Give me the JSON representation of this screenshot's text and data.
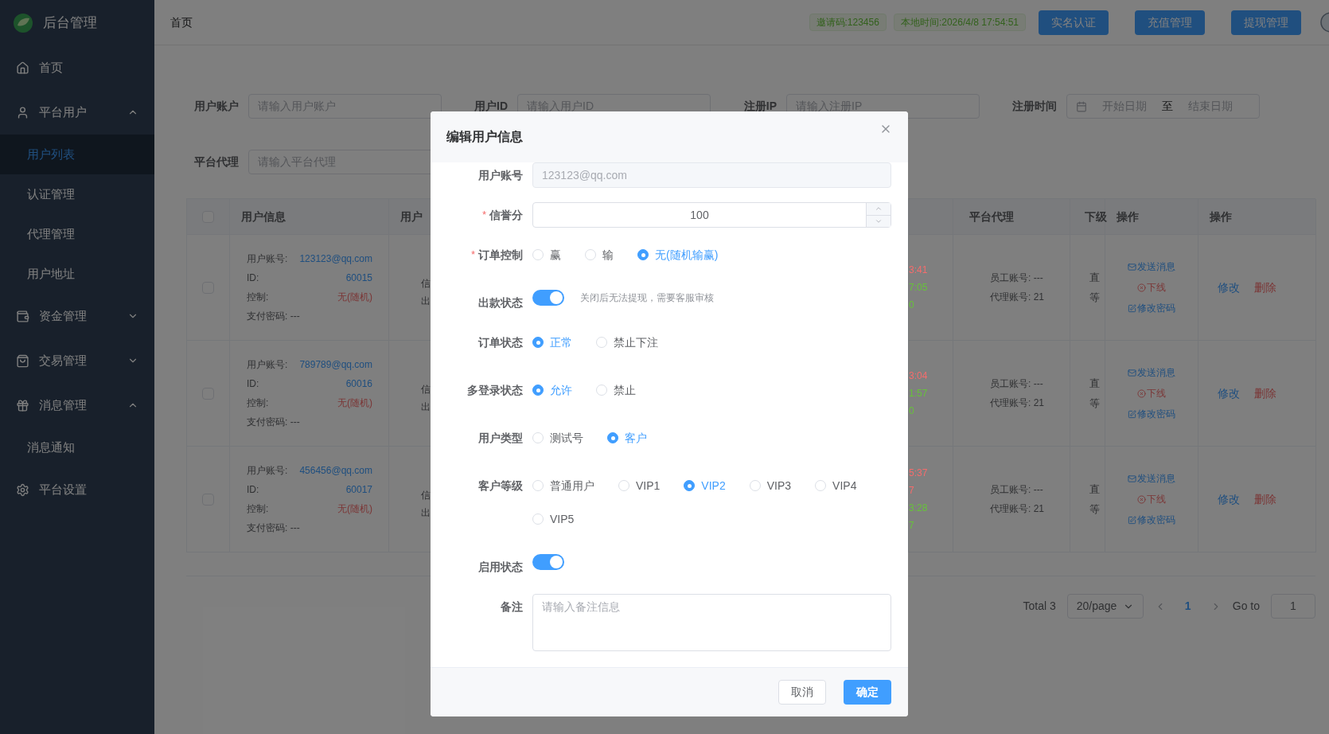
{
  "sidebar": {
    "logo_text": "后台管理",
    "items": [
      {
        "label": "首页",
        "selected": false
      },
      {
        "label": "平台用户",
        "selected": false,
        "expanded": true,
        "children": [
          {
            "label": "用户列表",
            "selected": true
          },
          {
            "label": "认证管理",
            "selected": false
          },
          {
            "label": "代理管理",
            "selected": false
          },
          {
            "label": "用户地址",
            "selected": false
          }
        ]
      },
      {
        "label": "资金管理",
        "selected": false,
        "expanded": false
      },
      {
        "label": "交易管理",
        "selected": false,
        "expanded": false
      },
      {
        "label": "消息管理",
        "selected": false,
        "expanded": true,
        "children": [
          {
            "label": "消息通知",
            "selected": false
          }
        ]
      },
      {
        "label": "平台设置",
        "selected": false
      }
    ]
  },
  "topbar": {
    "breadcrumb": "首页",
    "badges": [
      "邀请码:123456",
      "本地时间:2026/4/8 17:54:51"
    ],
    "buttons": [
      "实名认证",
      "充值管理",
      "提现管理"
    ]
  },
  "filters": [
    {
      "label": "用户账户",
      "placeholder": "请输入用户账户"
    },
    {
      "label": "用户ID",
      "placeholder": "请输入用户ID"
    },
    {
      "label": "注册IP",
      "placeholder": "请输入注册IP"
    },
    {
      "label": "平台代理",
      "placeholder": "请输入平台代理"
    }
  ],
  "date_filter": {
    "label": "注册时间",
    "start_placeholder": "开始日期",
    "separator": "至",
    "end_placeholder": "结束日期"
  },
  "table": {
    "all_checked": false,
    "columns": [
      "用户信息",
      "用户",
      "平台代理",
      "下级",
      "操作",
      "操作"
    ],
    "rows": [
      {
        "checked": false,
        "account_label": "用户账号:",
        "account": "123123@qq.com",
        "id_label": "ID:",
        "id": "60015",
        "control_label": "控制:",
        "control": "无(随机)",
        "pay_password": "支付密码: ---",
        "status_fragments": [
          "信",
          "出"
        ],
        "time_fragments": [
          {
            "text": "3:41",
            "color": "#f56c6c"
          },
          {
            "text": "7:05",
            "color": "#67c23a"
          },
          {
            "text": "0",
            "color": "#67c23a"
          }
        ],
        "staff": "员工账号: ---",
        "agent": "代理账号: 21",
        "level_fragments": [
          "直",
          "等"
        ],
        "actions": [
          {
            "kind": "message",
            "label": "发送消息"
          },
          {
            "kind": "offline",
            "label": "下线"
          },
          {
            "kind": "password",
            "label": "修改密码"
          }
        ],
        "ops": [
          {
            "kind": "edit",
            "label": "修改"
          },
          {
            "kind": "delete",
            "label": "删除"
          }
        ]
      },
      {
        "checked": false,
        "account_label": "用户账号:",
        "account": "789789@qq.com",
        "id_label": "ID:",
        "id": "60016",
        "control_label": "控制:",
        "control": "无(随机)",
        "pay_password": "支付密码: ---",
        "status_fragments": [
          "信",
          "出"
        ],
        "time_fragments": [
          {
            "text": "3:04",
            "color": "#f56c6c"
          },
          {
            "text": "1:57",
            "color": "#67c23a"
          },
          {
            "text": "0",
            "color": "#67c23a"
          }
        ],
        "staff": "员工账号: ---",
        "agent": "代理账号: 21",
        "level_fragments": [
          "直",
          "等"
        ],
        "actions": [
          {
            "kind": "message",
            "label": "发送消息"
          },
          {
            "kind": "offline",
            "label": "下线"
          },
          {
            "kind": "password",
            "label": "修改密码"
          }
        ],
        "ops": [
          {
            "kind": "edit",
            "label": "修改"
          },
          {
            "kind": "delete",
            "label": "删除"
          }
        ]
      },
      {
        "checked": false,
        "account_label": "用户账号:",
        "account": "456456@qq.com",
        "id_label": "ID:",
        "id": "60017",
        "control_label": "控制:",
        "control": "无(随机)",
        "pay_password": "支付密码: ---",
        "status_fragments": [
          "信",
          "出"
        ],
        "time_fragments": [
          {
            "text": "5:37",
            "color": "#f56c6c"
          },
          {
            "text": "7",
            "color": "#f56c6c"
          },
          {
            "text": "3:28",
            "color": "#67c23a"
          },
          {
            "text": "7",
            "color": "#67c23a"
          }
        ],
        "staff": "员工账号: ---",
        "agent": "代理账号: 21",
        "level_fragments": [
          "直",
          "等"
        ],
        "actions": [
          {
            "kind": "message",
            "label": "发送消息"
          },
          {
            "kind": "offline",
            "label": "下线"
          },
          {
            "kind": "password",
            "label": "修改密码"
          }
        ],
        "ops": [
          {
            "kind": "edit",
            "label": "修改"
          },
          {
            "kind": "delete",
            "label": "删除"
          }
        ]
      }
    ]
  },
  "pagination": {
    "total": "Total 3",
    "page_size": "20/page",
    "pages": [
      {
        "label": "1",
        "selected": true
      }
    ],
    "goto_label": "Go to",
    "goto_value": "1"
  },
  "modal": {
    "title": "编辑用户信息",
    "fields": [
      {
        "kind": "text",
        "label": "用户账号",
        "disabled": true,
        "value": "123123@qq.com"
      },
      {
        "kind": "number",
        "label": "信誉分",
        "required_mark": "*",
        "value": "100"
      },
      {
        "kind": "radio",
        "label": "订单控制",
        "required_mark": "*",
        "options": [
          {
            "label": "赢",
            "selected": false
          },
          {
            "label": "输",
            "selected": false
          },
          {
            "label": "无(随机输赢)",
            "selected": true
          }
        ]
      },
      {
        "kind": "switch",
        "label": "出款状态",
        "on": true,
        "hint": "关闭后无法提现，需要客服审核"
      },
      {
        "kind": "radio",
        "label": "订单状态",
        "options": [
          {
            "label": "正常",
            "selected": true
          },
          {
            "label": "禁止下注",
            "selected": false
          }
        ]
      },
      {
        "kind": "radio",
        "label": "多登录状态",
        "options": [
          {
            "label": "允许",
            "selected": true
          },
          {
            "label": "禁止",
            "selected": false
          }
        ]
      },
      {
        "kind": "radio",
        "label": "用户类型",
        "options": [
          {
            "label": "测试号",
            "selected": false
          },
          {
            "label": "客户",
            "selected": true
          }
        ]
      },
      {
        "kind": "radio",
        "label": "客户等级",
        "options": [
          {
            "label": "普通用户",
            "selected": false
          },
          {
            "label": "VIP1",
            "selected": false
          },
          {
            "label": "VIP2",
            "selected": true
          },
          {
            "label": "VIP3",
            "selected": false
          },
          {
            "label": "VIP4",
            "selected": false
          },
          {
            "label": "VIP5",
            "selected": false
          }
        ]
      },
      {
        "kind": "switch",
        "label": "启用状态",
        "on": true
      },
      {
        "kind": "textarea",
        "label": "备注",
        "placeholder": "请输入备注信息"
      }
    ],
    "buttons": [
      {
        "kind": "secondary",
        "label": "取消"
      },
      {
        "kind": "primary",
        "label": "确定"
      }
    ]
  }
}
